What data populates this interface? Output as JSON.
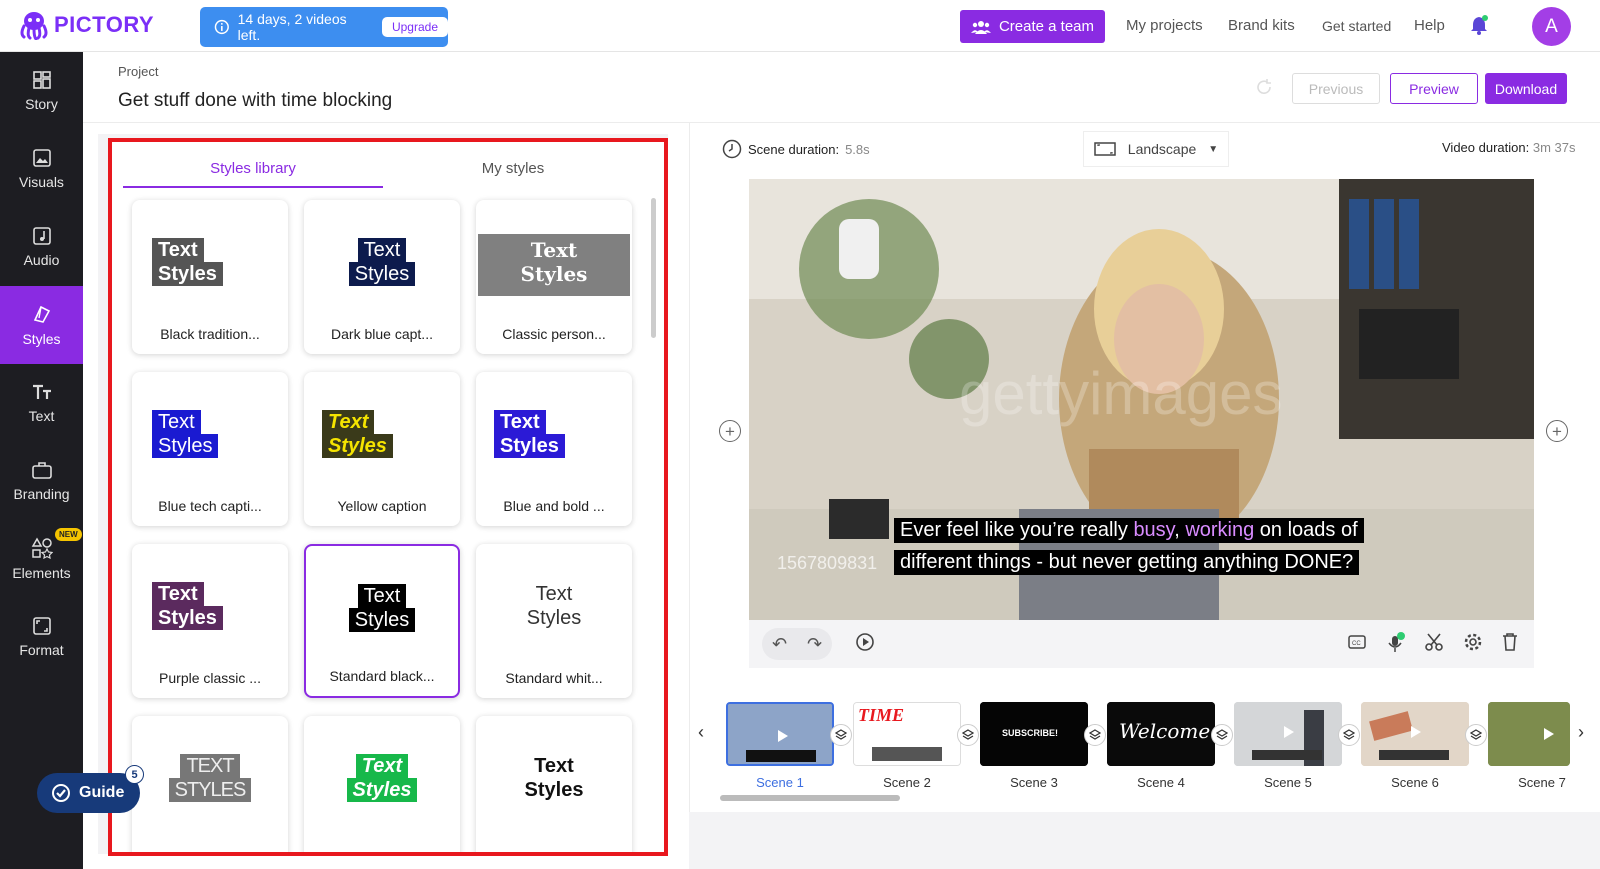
{
  "header": {
    "logo_text": "PICTORY",
    "trial_text": "14 days, 2 videos left.",
    "upgrade_label": "Upgrade",
    "create_team_label": "Create a team",
    "nav": [
      "My projects",
      "Brand kits",
      "Get started",
      "Help"
    ],
    "avatar_letter": "A"
  },
  "sidebar": {
    "items": [
      {
        "label": "Story",
        "icon": "grid-icon"
      },
      {
        "label": "Visuals",
        "icon": "image-icon"
      },
      {
        "label": "Audio",
        "icon": "music-icon"
      },
      {
        "label": "Styles",
        "icon": "paint-icon",
        "active": true
      },
      {
        "label": "Text",
        "icon": "text-icon"
      },
      {
        "label": "Branding",
        "icon": "briefcase-icon"
      },
      {
        "label": "Elements",
        "icon": "shapes-icon",
        "badge": "NEW"
      },
      {
        "label": "Format",
        "icon": "format-icon"
      }
    ]
  },
  "project": {
    "label": "Project",
    "title": "Get stuff done with time blocking",
    "previous_label": "Previous",
    "preview_label": "Preview",
    "download_label": "Download"
  },
  "styles_panel": {
    "tabs": [
      "Styles library",
      "My styles"
    ],
    "cards": [
      {
        "label": "Black tradition...",
        "line1": "Text",
        "line2": "Styles"
      },
      {
        "label": "Dark blue capt...",
        "line1": "Text",
        "line2": "Styles"
      },
      {
        "label": "Classic person...",
        "line1": "Text",
        "line2": "Styles"
      },
      {
        "label": "Blue tech capti...",
        "line1": "Text",
        "line2": "Styles"
      },
      {
        "label": "Yellow caption",
        "line1": "Text",
        "line2": "Styles"
      },
      {
        "label": "Blue and bold ...",
        "line1": "Text",
        "line2": "Styles"
      },
      {
        "label": "Purple classic ...",
        "line1": "Text",
        "line2": "Styles"
      },
      {
        "label": "Standard black...",
        "line1": "Text",
        "line2": "Styles"
      },
      {
        "label": "Standard whit...",
        "line1": "Text",
        "line2": "Styles"
      },
      {
        "label": "",
        "line1": "TEXT",
        "line2": "STYLES"
      },
      {
        "label": "",
        "line1": "Text",
        "line2": "Styles"
      },
      {
        "label": "",
        "line1": "Text",
        "line2": "Styles"
      }
    ]
  },
  "guide": {
    "label": "Guide",
    "count": "5"
  },
  "editor": {
    "scene_duration_label": "Scene duration:",
    "scene_duration_value": "5.8s",
    "orientation": "Landscape",
    "video_duration_label": "Video duration:",
    "video_duration_value": "3m 37s",
    "watermark": "gettyimages",
    "watermark_number": "1567809831",
    "caption_line1_pre": "Ever feel like you’re really ",
    "caption_hl1": "busy",
    "caption_comma": ", ",
    "caption_hl2": "working",
    "caption_line1_post": " on loads of",
    "caption_line2": "different things - but never getting anything DONE?"
  },
  "scenes": [
    {
      "label": "Scene 1",
      "active": true
    },
    {
      "label": "Scene 2"
    },
    {
      "label": "Scene 3"
    },
    {
      "label": "Scene 4"
    },
    {
      "label": "Scene 5"
    },
    {
      "label": "Scene 6"
    },
    {
      "label": "Scene 7"
    }
  ],
  "colors": {
    "accent": "#8a2be2",
    "highlight_box": "#e8181e",
    "trial_blue": "#3d8ef0",
    "sidebar_bg": "#1d1d22"
  }
}
